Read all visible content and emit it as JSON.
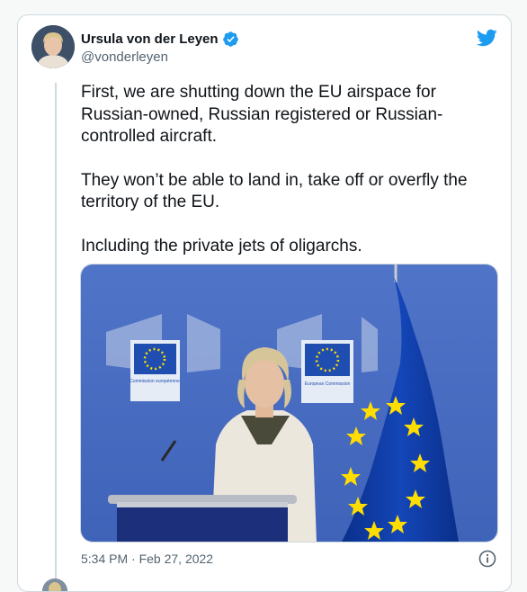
{
  "tweet": {
    "author_name": "Ursula von der Leyen",
    "author_handle": "@vonderleyen",
    "paragraphs": [
      "First, we are shutting down the EU airspace for Russian-owned, Russian registered or Russian-controlled aircraft.",
      "They won’t be able to land in, take off or overfly the territory of the EU.",
      "Including the private jets of oligarchs."
    ],
    "timestamp": "5:34 PM · Feb 27, 2022",
    "media": {
      "banner_labels": [
        "Commission européenne",
        "European Commission"
      ]
    }
  },
  "colors": {
    "twitter_blue": "#1d9bf0",
    "text_primary": "#0f1419",
    "text_secondary": "#536471",
    "eu_blue": "#0b3d9f",
    "eu_gold": "#ffdd00"
  },
  "icons": {
    "verified": "verified-badge-icon",
    "logo": "twitter-bird-icon",
    "info": "info-circle-icon"
  }
}
